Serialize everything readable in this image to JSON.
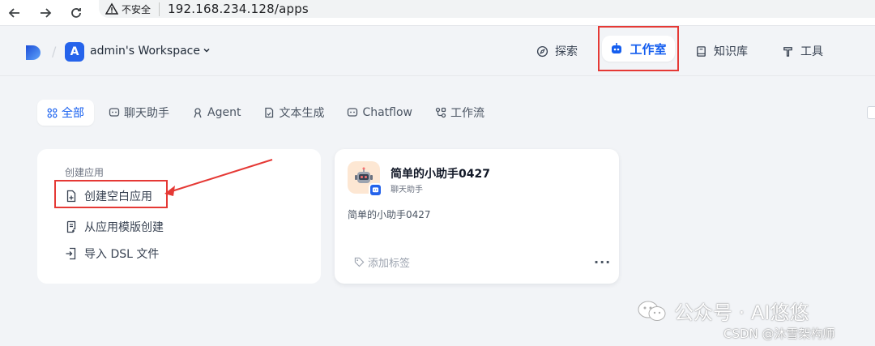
{
  "browser": {
    "back_icon": "arrow-left-icon",
    "forward_icon": "arrow-right-icon",
    "reload_icon": "reload-icon",
    "insecure_label": "不安全",
    "url": "192.168.234.128/apps"
  },
  "header": {
    "workspace_initial": "A",
    "workspace_name": "admin's Workspace",
    "nav": {
      "explore": "探索",
      "studio": "工作室",
      "knowledge": "知识库",
      "tools": "工具"
    }
  },
  "filters": {
    "all": "全部",
    "chatbot": "聊天助手",
    "agent": "Agent",
    "text_gen": "文本生成",
    "chatflow": "Chatflow",
    "workflow": "工作流"
  },
  "create": {
    "title": "创建应用",
    "blank": "创建空白应用",
    "template": "从应用模版创建",
    "dsl": "导入 DSL 文件"
  },
  "app": {
    "name": "简单的小助手0427",
    "type": "聊天助手",
    "description": "简单的小助手0427",
    "tag_placeholder": "添加标签",
    "more": "···"
  },
  "watermarks": {
    "wechat": "公众号 · AI悠悠",
    "csdn": "CSDN @沐雪架构师"
  },
  "colors": {
    "accent": "#155eef",
    "annotation": "#e53935",
    "workspace_avatar": "#2563eb"
  }
}
